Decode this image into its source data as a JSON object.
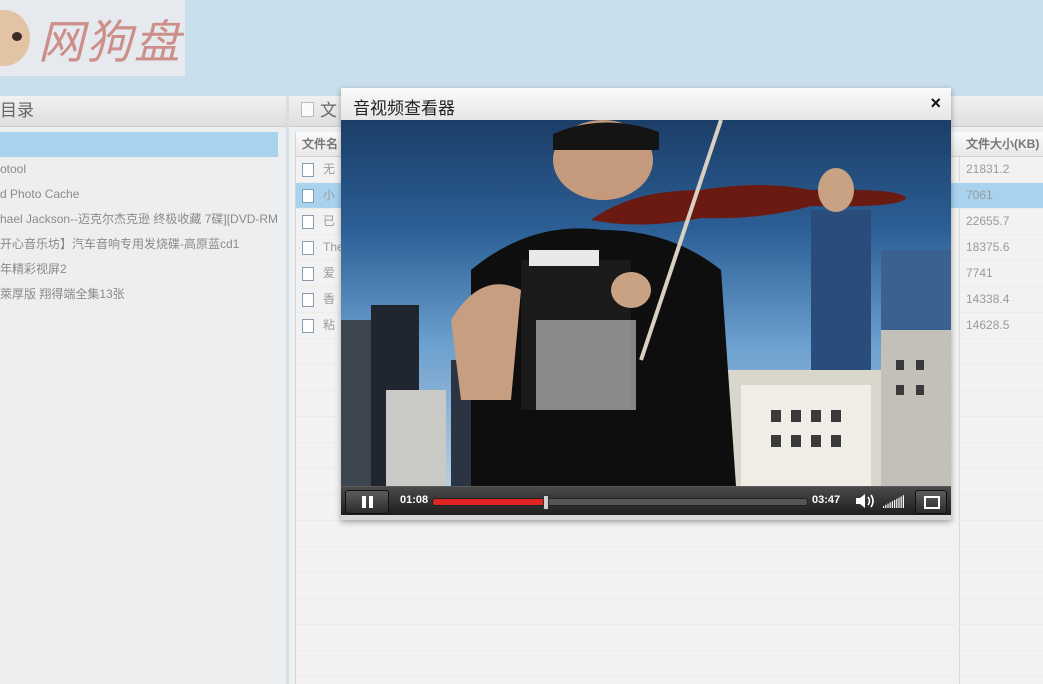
{
  "header": {
    "logo_text": "网狗盘",
    "logo_icon": "dog-logo"
  },
  "left_panel": {
    "title": "目录",
    "items": [
      {
        "label": "",
        "selected": true
      },
      {
        "label": "otool",
        "selected": false
      },
      {
        "label": "d Photo Cache",
        "selected": false
      },
      {
        "label": "hael Jackson--迈克尔杰克逊 终极收藏 7碟][DVD-RM",
        "selected": false
      },
      {
        "label": "开心音乐坊】汽车音响专用发烧碟-高原蓝cd1",
        "selected": false
      },
      {
        "label": "年精彩视屏2",
        "selected": false
      },
      {
        "label": "萊厚版 翔得端全集13张",
        "selected": false
      }
    ]
  },
  "right_panel": {
    "title": "文",
    "columns": {
      "name": "文件名",
      "size": "文件大小(KB)"
    },
    "rows": [
      {
        "name": "无",
        "size": "21831.2",
        "selected": false
      },
      {
        "name": "小",
        "size": "7061",
        "selected": true
      },
      {
        "name": "已",
        "size": "22655.7",
        "selected": false
      },
      {
        "name": "The",
        "size": "18375.6",
        "selected": false
      },
      {
        "name": "爱",
        "size": "7741",
        "selected": false
      },
      {
        "name": "香",
        "size": "14338.4",
        "selected": false
      },
      {
        "name": "粘",
        "size": "14628.5",
        "selected": false
      }
    ]
  },
  "dialog": {
    "title": "音视频查看器",
    "close_label": "×",
    "player": {
      "current_time": "01:08",
      "total_time": "03:47",
      "progress": 0.3,
      "volume": 1.0,
      "state": "playing",
      "accent_color": "#e02424"
    }
  }
}
